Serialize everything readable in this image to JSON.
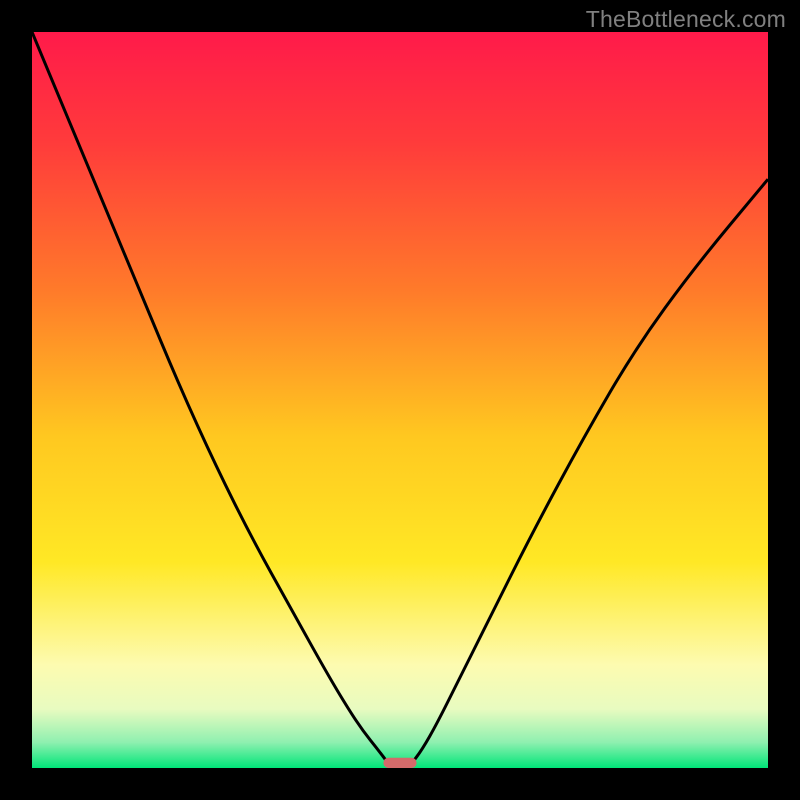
{
  "watermark": "TheBottleneck.com",
  "chart_data": {
    "type": "line",
    "title": "",
    "xlabel": "",
    "ylabel": "",
    "xlim": [
      0,
      100
    ],
    "ylim": [
      0,
      100
    ],
    "gradient_stops": [
      {
        "offset": 0.0,
        "color": "#ff1a4a"
      },
      {
        "offset": 0.15,
        "color": "#ff3b3b"
      },
      {
        "offset": 0.35,
        "color": "#ff7a2a"
      },
      {
        "offset": 0.55,
        "color": "#ffc820"
      },
      {
        "offset": 0.72,
        "color": "#ffe825"
      },
      {
        "offset": 0.86,
        "color": "#fdfbb0"
      },
      {
        "offset": 0.92,
        "color": "#e8fbc0"
      },
      {
        "offset": 0.965,
        "color": "#8ff0b0"
      },
      {
        "offset": 1.0,
        "color": "#00e578"
      }
    ],
    "series": [
      {
        "name": "left-curve",
        "x": [
          0,
          5,
          10,
          15,
          20,
          25,
          30,
          35,
          40,
          43,
          45,
          47,
          48.5
        ],
        "y": [
          100,
          88,
          76,
          64,
          52,
          41,
          31,
          22,
          13,
          8,
          5,
          2.5,
          0.5
        ]
      },
      {
        "name": "right-curve",
        "x": [
          51.5,
          53,
          55,
          58,
          62,
          68,
          75,
          82,
          90,
          100
        ],
        "y": [
          0.5,
          2.5,
          6,
          12,
          20,
          32,
          45,
          57,
          68,
          80
        ]
      }
    ],
    "marker": {
      "x_center": 50,
      "width": 4.5,
      "height": 1.4,
      "color": "#d46a6a"
    }
  }
}
